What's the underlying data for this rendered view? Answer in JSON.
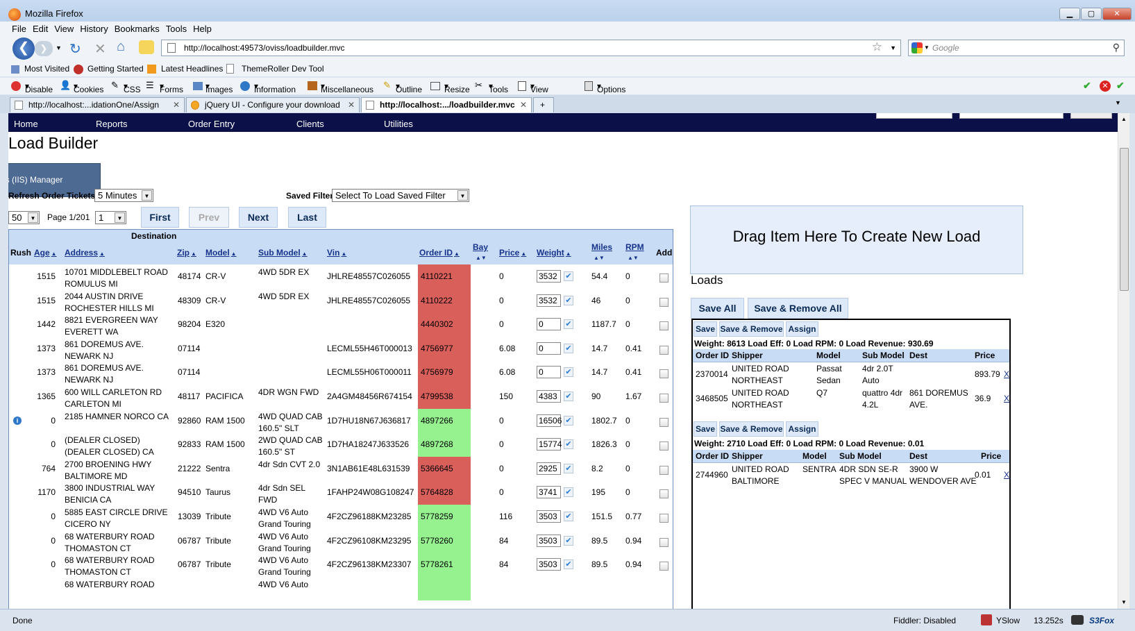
{
  "window": {
    "title": "Mozilla Firefox",
    "min": "▁",
    "max": "▢",
    "close": "✕"
  },
  "menu": [
    "File",
    "Edit",
    "View",
    "History",
    "Bookmarks",
    "Tools",
    "Help"
  ],
  "url": "http://localhost:49573/oviss/loadbuilder.mvc",
  "search_placeholder": "Google",
  "bookmarks": [
    "Most Visited",
    "Getting Started",
    "Latest Headlines",
    "ThemeRoller Dev Tool"
  ],
  "devtoolbar": [
    "Disable",
    "Cookies",
    "CSS",
    "Forms",
    "Images",
    "Information",
    "Miscellaneous",
    "Outline",
    "Resize",
    "Tools",
    "View Source",
    "Options"
  ],
  "tabs": [
    {
      "label": "http://localhost:...idationOne/Assign"
    },
    {
      "label": "jQuery UI - Configure your download"
    },
    {
      "label": "http://localhost:.../loadbuilder.mvc"
    }
  ],
  "sitenav": [
    "Home",
    "Reports",
    "Order Entry",
    "Clients",
    "Utilities"
  ],
  "page": {
    "title": "Load Builder",
    "iis_popup": "es (IIS) Manager",
    "refresh_label": "Refresh Order Tickets",
    "refresh_value": "5 Minutes",
    "saved_filters_label": "Saved Filters",
    "saved_filters_value": "Select To Load Saved Filter",
    "page_size": "50",
    "page_label": "Page 1/201",
    "page_value": "1",
    "btn_first": "First",
    "btn_prev": "Prev",
    "btn_next": "Next",
    "btn_last": "Last"
  },
  "grid": {
    "group_header": "Destination",
    "headers": {
      "rush": "Rush",
      "age": "Age",
      "address": "Address",
      "zip": "Zip",
      "model": "Model",
      "submodel": "Sub Model",
      "vin": "Vin",
      "orderid": "Order ID",
      "bay": "Bay",
      "price": "Price",
      "weight": "Weight",
      "miles": "Miles",
      "rpm": "RPM",
      "add": "Add"
    },
    "rows": [
      {
        "rush": "",
        "age": "1515",
        "addr1": "10701 MIDDLEBELT ROAD",
        "addr2": "ROMULUS MI",
        "zip": "48174",
        "model": "CR-V",
        "sub1": "4WD 5DR EX",
        "sub2": "",
        "vin": "JHLRE48557C026055",
        "oid": "4110221",
        "color": "red",
        "price": "0",
        "weight": "3532",
        "miles": "54.4",
        "rpm": "0"
      },
      {
        "rush": "",
        "age": "1515",
        "addr1": "2044 AUSTIN DRIVE",
        "addr2": "ROCHESTER HILLS MI",
        "zip": "48309",
        "model": "CR-V",
        "sub1": "4WD 5DR EX",
        "sub2": "",
        "vin": "JHLRE48557C026055",
        "oid": "4110222",
        "color": "red",
        "price": "0",
        "weight": "3532",
        "miles": "46",
        "rpm": "0"
      },
      {
        "rush": "",
        "age": "1442",
        "addr1": "8821 EVERGREEN WAY",
        "addr2": "EVERETT WA",
        "zip": "98204",
        "model": "E320",
        "sub1": "",
        "sub2": "",
        "vin": "",
        "oid": "4440302",
        "color": "red",
        "price": "0",
        "weight": "0",
        "miles": "1187.7",
        "rpm": "0"
      },
      {
        "rush": "",
        "age": "1373",
        "addr1": "861 DOREMUS AVE.",
        "addr2": "NEWARK NJ",
        "zip": "07114",
        "model": "",
        "sub1": "",
        "sub2": "",
        "vin": "LECML55H46T000013",
        "oid": "4756977",
        "color": "red",
        "price": "6.08",
        "weight": "0",
        "miles": "14.7",
        "rpm": "0.41"
      },
      {
        "rush": "",
        "age": "1373",
        "addr1": "861 DOREMUS AVE.",
        "addr2": "NEWARK NJ",
        "zip": "07114",
        "model": "",
        "sub1": "",
        "sub2": "",
        "vin": "LECML55H06T000011",
        "oid": "4756979",
        "color": "red",
        "price": "6.08",
        "weight": "0",
        "miles": "14.7",
        "rpm": "0.41"
      },
      {
        "rush": "",
        "age": "1365",
        "addr1": "600 WILL CARLETON RD",
        "addr2": "CARLETON MI",
        "zip": "48117",
        "model": "PACIFICA",
        "sub1": "4DR WGN FWD",
        "sub2": "",
        "vin": "2A4GM48456R674154",
        "oid": "4799538",
        "color": "red",
        "price": "150",
        "weight": "4383",
        "miles": "90",
        "rpm": "1.67"
      },
      {
        "rush": "i",
        "age": "0",
        "addr1": "2185 HAMNER NORCO CA",
        "addr2": "",
        "zip": "92860",
        "model": "RAM 1500",
        "sub1": "4WD QUAD CAB",
        "sub2": "160.5\" SLT",
        "vin": "1D7HU18N67J636817",
        "oid": "4897266",
        "color": "green",
        "price": "0",
        "weight": "16506",
        "miles": "1802.7",
        "rpm": "0"
      },
      {
        "rush": "",
        "age": "0",
        "addr1": "(DEALER CLOSED)",
        "addr2": "(DEALER CLOSED) CA",
        "zip": "92833",
        "model": "RAM 1500",
        "sub1": "2WD QUAD CAB",
        "sub2": "160.5\" ST",
        "vin": "1D7HA18247J633526",
        "oid": "4897268",
        "color": "green",
        "price": "0",
        "weight": "15774",
        "miles": "1826.3",
        "rpm": "0"
      },
      {
        "rush": "",
        "age": "764",
        "addr1": "2700 BROENING HWY",
        "addr2": "BALTIMORE MD",
        "zip": "21222",
        "model": "Sentra",
        "sub1": "4dr Sdn CVT 2.0",
        "sub2": "",
        "vin": "3N1AB61E48L631539",
        "oid": "5366645",
        "color": "red",
        "price": "0",
        "weight": "2925",
        "miles": "8.2",
        "rpm": "0"
      },
      {
        "rush": "",
        "age": "1170",
        "addr1": "3800 INDUSTRIAL WAY",
        "addr2": "BENICIA CA",
        "zip": "94510",
        "model": "Taurus",
        "sub1": "4dr Sdn SEL",
        "sub2": "FWD",
        "vin": "1FAHP24W08G108247",
        "oid": "5764828",
        "color": "red",
        "price": "0",
        "weight": "3741",
        "miles": "195",
        "rpm": "0"
      },
      {
        "rush": "",
        "age": "0",
        "addr1": "5885 EAST CIRCLE DRIVE",
        "addr2": "CICERO NY",
        "zip": "13039",
        "model": "Tribute",
        "sub1": "4WD V6 Auto",
        "sub2": "Grand Touring",
        "vin": "4F2CZ96188KM23285",
        "oid": "5778259",
        "color": "green",
        "price": "116",
        "weight": "3503",
        "miles": "151.5",
        "rpm": "0.77"
      },
      {
        "rush": "",
        "age": "0",
        "addr1": "68 WATERBURY ROAD",
        "addr2": "THOMASTON CT",
        "zip": "06787",
        "model": "Tribute",
        "sub1": "4WD V6 Auto",
        "sub2": "Grand Touring",
        "vin": "4F2CZ96108KM23295",
        "oid": "5778260",
        "color": "green",
        "price": "84",
        "weight": "3503",
        "miles": "89.5",
        "rpm": "0.94"
      },
      {
        "rush": "",
        "age": "0",
        "addr1": "68 WATERBURY ROAD",
        "addr2": "THOMASTON CT",
        "zip": "06787",
        "model": "Tribute",
        "sub1": "4WD V6 Auto",
        "sub2": "Grand Touring",
        "vin": "4F2CZ96138KM23307",
        "oid": "5778261",
        "color": "green",
        "price": "84",
        "weight": "3503",
        "miles": "89.5",
        "rpm": "0.94"
      },
      {
        "rush": "",
        "age": "",
        "addr1": "68 WATERBURY ROAD",
        "addr2": "",
        "zip": "",
        "model": "",
        "sub1": "4WD V6 Auto",
        "sub2": "",
        "vin": "",
        "oid": "",
        "color": "green",
        "price": "",
        "weight": "",
        "miles": "",
        "rpm": ""
      }
    ]
  },
  "loads_panel": {
    "dropzone": "Drag Item Here To Create New Load",
    "title": "Loads",
    "save_all": "Save All",
    "save_remove_all": "Save & Remove All",
    "loads": [
      {
        "btn_save": "Save",
        "btn_save_remove": "Save & Remove",
        "btn_assign": "Assign",
        "summary": "Weight: 8613 Load Eff: 0 Load RPM: 0 Load Revenue: 930.69",
        "headers": [
          "Order ID",
          "Shipper",
          "Model",
          "Sub Model",
          "Dest",
          "Price"
        ],
        "rows": [
          {
            "oid": "2370014",
            "ship1": "UNITED ROAD",
            "ship2": "NORTHEAST",
            "model1": "Passat",
            "model2": "Sedan",
            "sub1": "4dr 2.0T",
            "sub2": "Auto",
            "dest1": "",
            "dest2": "",
            "price": "893.79",
            "x": "X"
          },
          {
            "oid": "3468505",
            "ship1": "UNITED ROAD",
            "ship2": "NORTHEAST",
            "model1": "Q7",
            "model2": "",
            "sub1": "quattro 4dr",
            "sub2": "4.2L",
            "dest1": "861 DOREMUS",
            "dest2": "AVE.",
            "price": "36.9",
            "x": "X"
          }
        ]
      },
      {
        "btn_save": "Save",
        "btn_save_remove": "Save & Remove",
        "btn_assign": "Assign",
        "summary": "Weight: 2710 Load Eff: 0 Load RPM: 0 Load Revenue: 0.01",
        "headers": [
          "Order ID",
          "Shipper",
          "Model",
          "Sub Model",
          "Dest",
          "Price"
        ],
        "rows": [
          {
            "oid": "2744960",
            "ship1": "UNITED ROAD",
            "ship2": "BALTIMORE",
            "model1": "SENTRA",
            "model2": "",
            "sub1": "4DR SDN SE-R",
            "sub2": "SPEC V MANUAL",
            "dest1": "3900 W",
            "dest2": "WENDOVER AVE",
            "price": "0.01",
            "x": "X"
          }
        ]
      }
    ]
  },
  "status": {
    "left": "Done",
    "fiddler": "Fiddler: Disabled",
    "yslow": "YSlow",
    "time": "13.252s",
    "s3fox": "S3Fox"
  }
}
